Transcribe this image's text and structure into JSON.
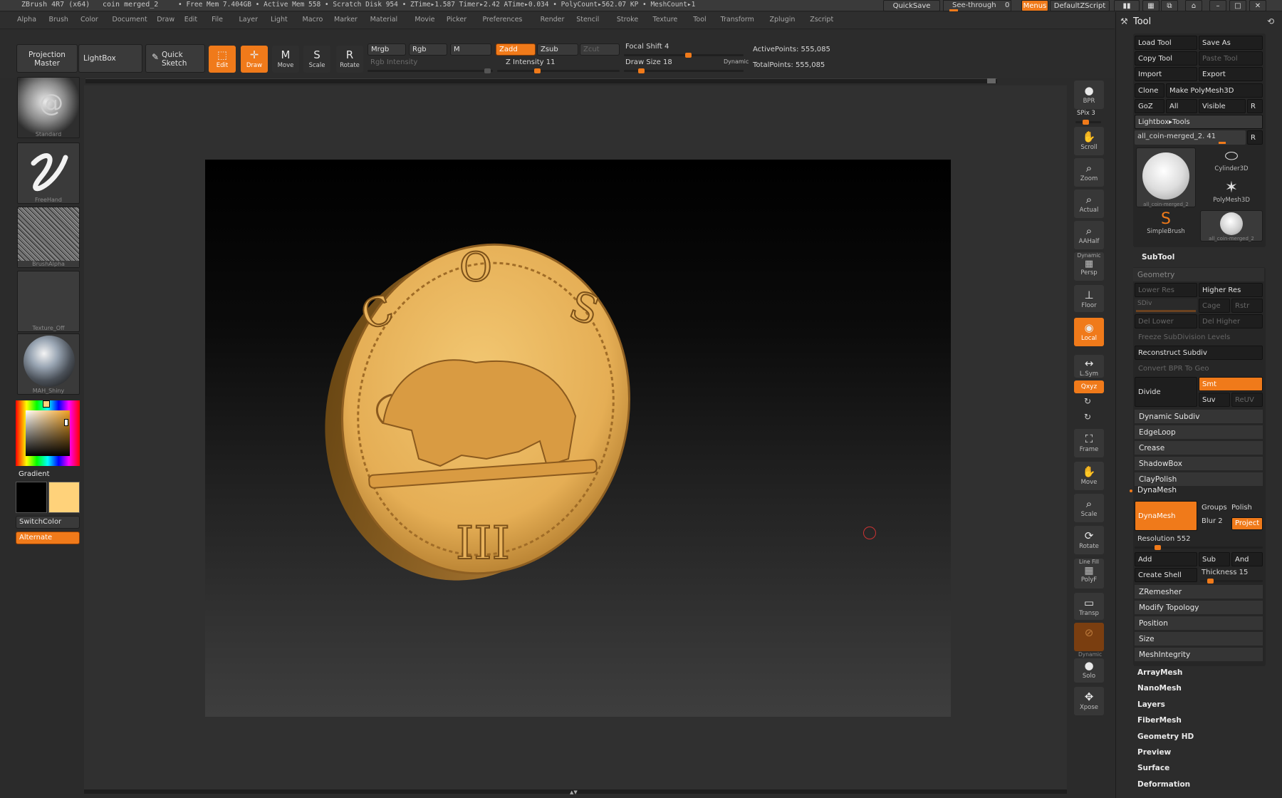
{
  "titlebar": {
    "app": "ZBrush 4R7 (x64)",
    "doc": "coin merged_2",
    "stats": "• Free Mem 7.404GB • Active Mem 558 • Scratch Disk 954 • ZTime▸1.587 Timer▸2.42 ATime▸0.034 • PolyCount▸562.07 KP • MeshCount▸1",
    "quicksave": "QuickSave",
    "seethrough": "See-through",
    "seethrough_val": "0",
    "menus": "Menus",
    "defaultzscript": "DefaultZScript"
  },
  "menubar": [
    "Alpha",
    "Brush",
    "Color",
    "Document",
    "Draw",
    "Edit",
    "File",
    "Layer",
    "Light",
    "Macro",
    "Marker",
    "Material",
    "Movie",
    "Picker",
    "Preferences",
    "Render",
    "Stencil",
    "Stroke",
    "Texture",
    "Tool",
    "Transform",
    "Zplugin",
    "Zscript"
  ],
  "shelf": {
    "projection_master": "Projection Master",
    "lightbox": "LightBox",
    "quick_sketch": "Quick Sketch",
    "edit": "Edit",
    "draw": "Draw",
    "move": "Move",
    "scale": "Scale",
    "rotate": "Rotate",
    "mrgb": "Mrgb",
    "rgb": "Rgb",
    "m": "M",
    "rgb_intensity": "Rgb Intensity",
    "zadd": "Zadd",
    "zsub": "Zsub",
    "zcut": "Zcut",
    "z_intensity": "Z Intensity 11",
    "focal_shift": "Focal Shift 4",
    "draw_size": "Draw Size 18",
    "dynamic": "Dynamic",
    "active_points": "ActivePoints: 555,085",
    "total_points": "TotalPoints: 555,085"
  },
  "left": {
    "standard": "Standard",
    "freehand": "FreeHand",
    "brushalpha": "BrushAlpha",
    "texture_off": "Texture_Off",
    "material": "MAH_Shiny",
    "gradient": "Gradient",
    "switchcolor": "SwitchColor",
    "alternate": "Alternate",
    "main_color": "#000000",
    "secondary_color": "#ffd27a"
  },
  "coin": {
    "top": "O",
    "left": "C",
    "right": "S",
    "bottom": "III"
  },
  "rightstrip": {
    "bpr": "BPR",
    "spix": "SPix 3",
    "scroll": "Scroll",
    "zoom": "Zoom",
    "actual": "Actual",
    "aahalf": "AAHalf",
    "dynamic": "Dynamic",
    "persp": "Persp",
    "floor": "Floor",
    "local": "Local",
    "lsym": "L.Sym",
    "xyz": "Qxyz",
    "frame": "Frame",
    "move": "Move",
    "scale": "Scale",
    "rotate": "Rotate",
    "linefill": "Line Fill",
    "polyf": "PolyF",
    "transp": "Transp",
    "ghost": "Dynamic",
    "solo": "Solo",
    "xpose": "Xpose"
  },
  "tool": {
    "title": "Tool",
    "load_tool": "Load Tool",
    "save_as": "Save As",
    "copy_tool": "Copy Tool",
    "paste_tool": "Paste Tool",
    "import": "Import",
    "export": "Export",
    "clone": "Clone",
    "make_polymesh": "Make PolyMesh3D",
    "goz": "GoZ",
    "all": "All",
    "visible": "Visible",
    "r": "R",
    "lightbox_tools": "Lightbox▸Tools",
    "current_tool": "all_coin-merged_2. 41",
    "thumbs": {
      "coin": "all_coin-merged_2",
      "cylinder": "Cylinder3D",
      "polymesh": "PolyMesh3D",
      "simplebrush": "SimpleBrush",
      "coin2": "all_coin-merged_2"
    },
    "subtool": "SubTool",
    "geometry": "Geometry",
    "lower_res": "Lower Res",
    "higher_res": "Higher Res",
    "sdiv": "SDiv",
    "cage": "Cage",
    "rstr": "Rstr",
    "del_lower": "Del Lower",
    "del_higher": "Del Higher",
    "freeze": "Freeze SubDivision Levels",
    "reconstruct": "Reconstruct Subdiv",
    "convert_bpr": "Convert BPR To Geo",
    "divide": "Divide",
    "smt": "Smt",
    "suv": "Suv",
    "reuv": "ReUV",
    "sections": [
      "Dynamic Subdiv",
      "EdgeLoop",
      "Crease",
      "ShadowBox",
      "ClayPolish"
    ],
    "dynamesh_header": "DynaMesh",
    "dynamesh_btn": "DynaMesh",
    "groups": "Groups",
    "polish": "Polish",
    "blur": "Blur 2",
    "project": "Project",
    "resolution": "Resolution 552",
    "add": "Add",
    "sub": "Sub",
    "and": "And",
    "create_shell": "Create Shell",
    "thickness": "Thickness 15",
    "sections2": [
      "ZRemesher",
      "Modify Topology",
      "Position",
      "Size",
      "MeshIntegrity"
    ],
    "sections3": [
      "ArrayMesh",
      "NanoMesh",
      "Layers",
      "FiberMesh",
      "Geometry HD",
      "Preview",
      "Surface",
      "Deformation"
    ]
  },
  "colors": {
    "accent": "#f07a1a",
    "coin_gold": "#e8b45a",
    "panel": "#2c2c2c"
  }
}
